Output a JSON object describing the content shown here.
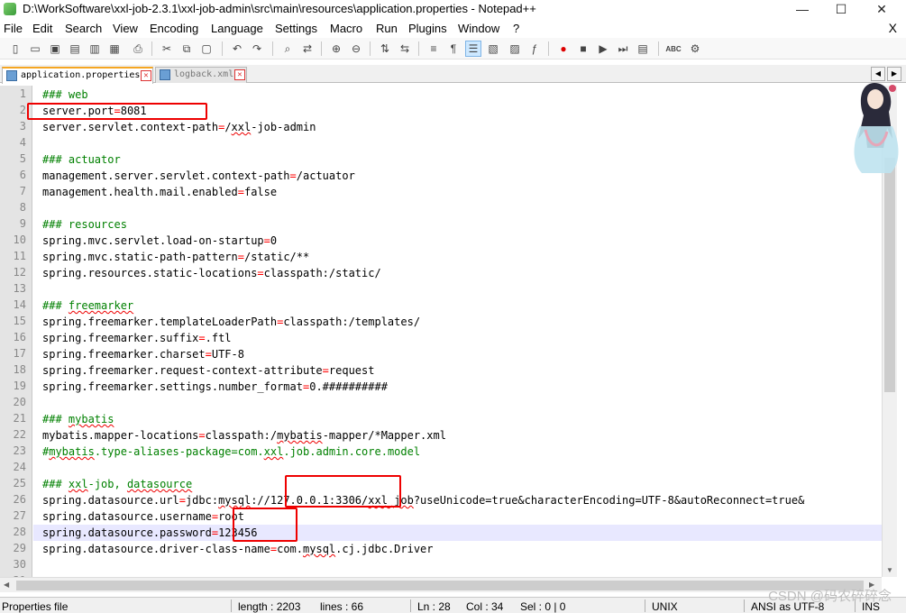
{
  "window": {
    "title": "D:\\WorkSoftware\\xxl-job-2.3.1\\xxl-job-admin\\src\\main\\resources\\application.properties - Notepad++",
    "minimize": "—",
    "maximize": "☐",
    "close": "✕"
  },
  "menu": {
    "items": [
      "File",
      "Edit",
      "Search",
      "View",
      "Encoding",
      "Language",
      "Settings",
      "Macro",
      "Run",
      "Plugins",
      "Window",
      "?"
    ],
    "close_doc": "X"
  },
  "tabs": [
    {
      "label": "application.properties",
      "active": true
    },
    {
      "label": "logback.xml",
      "active": false
    }
  ],
  "editor": {
    "current_line": 28,
    "lines": [
      {
        "n": 1,
        "type": "comment",
        "text": "### web"
      },
      {
        "n": 2,
        "type": "prop",
        "key": "server.port",
        "value": "8081"
      },
      {
        "n": 3,
        "type": "prop",
        "key": "server.servlet.context-path",
        "value": "/xxl-job-admin"
      },
      {
        "n": 4,
        "type": "blank"
      },
      {
        "n": 5,
        "type": "comment",
        "text": "### actuator"
      },
      {
        "n": 6,
        "type": "prop",
        "key": "management.server.servlet.context-path",
        "value": "/actuator"
      },
      {
        "n": 7,
        "type": "prop",
        "key": "management.health.mail.enabled",
        "value": "false"
      },
      {
        "n": 8,
        "type": "blank"
      },
      {
        "n": 9,
        "type": "comment",
        "text": "### resources"
      },
      {
        "n": 10,
        "type": "prop",
        "key": "spring.mvc.servlet.load-on-startup",
        "value": "0"
      },
      {
        "n": 11,
        "type": "prop",
        "key": "spring.mvc.static-path-pattern",
        "value": "/static/**"
      },
      {
        "n": 12,
        "type": "prop",
        "key": "spring.resources.static-locations",
        "value": "classpath:/static/"
      },
      {
        "n": 13,
        "type": "blank"
      },
      {
        "n": 14,
        "type": "comment",
        "text": "### freemarker"
      },
      {
        "n": 15,
        "type": "prop",
        "key": "spring.freemarker.templateLoaderPath",
        "value": "classpath:/templates/"
      },
      {
        "n": 16,
        "type": "prop",
        "key": "spring.freemarker.suffix",
        "value": ".ftl"
      },
      {
        "n": 17,
        "type": "prop",
        "key": "spring.freemarker.charset",
        "value": "UTF-8"
      },
      {
        "n": 18,
        "type": "prop",
        "key": "spring.freemarker.request-context-attribute",
        "value": "request"
      },
      {
        "n": 19,
        "type": "prop",
        "key": "spring.freemarker.settings.number_format",
        "value": "0.##########"
      },
      {
        "n": 20,
        "type": "blank"
      },
      {
        "n": 21,
        "type": "comment",
        "text": "### mybatis"
      },
      {
        "n": 22,
        "type": "prop",
        "key": "mybatis.mapper-locations",
        "value": "classpath:/mybatis-mapper/*Mapper.xml"
      },
      {
        "n": 23,
        "type": "comment",
        "text": "#mybatis.type-aliases-package=com.xxl.job.admin.core.model"
      },
      {
        "n": 24,
        "type": "blank"
      },
      {
        "n": 25,
        "type": "comment",
        "text": "### xxl-job, datasource"
      },
      {
        "n": 26,
        "type": "prop",
        "key": "spring.datasource.url",
        "value": "jdbc:mysql://127.0.0.1:3306/xxl_job?useUnicode=true&characterEncoding=UTF-8&autoReconnect=true&"
      },
      {
        "n": 27,
        "type": "prop",
        "key": "spring.datasource.username",
        "value": "root"
      },
      {
        "n": 28,
        "type": "prop",
        "key": "spring.datasource.password",
        "value": "123456"
      },
      {
        "n": 29,
        "type": "prop",
        "key": "spring.datasource.driver-class-name",
        "value": "com.mysql.cj.jdbc.Driver"
      },
      {
        "n": 30,
        "type": "blank"
      },
      {
        "n": 31,
        "type": "comment",
        "text": "###"
      }
    ]
  },
  "status": {
    "file_type": "Properties file",
    "length": "length : 2203",
    "lines": "lines : 66",
    "ln": "Ln : 28",
    "col": "Col : 34",
    "sel": "Sel : 0 | 0",
    "eol": "UNIX",
    "encoding": "ANSI as UTF-8",
    "mode": "INS"
  },
  "watermark": "CSDN @码农碎碎念"
}
